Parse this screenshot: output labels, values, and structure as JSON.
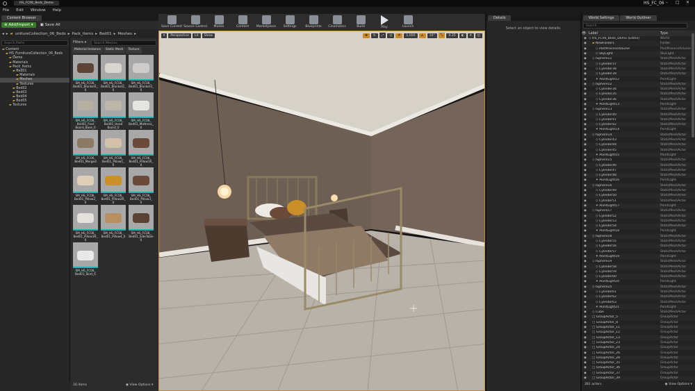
{
  "window": {
    "title": "HS_FC06_Beds_Demo",
    "project": "HS_FC_06"
  },
  "menu": [
    "File",
    "Edit",
    "Window",
    "Help"
  ],
  "content_browser": {
    "tab": "Content Browser",
    "add_import": "Add/Import",
    "save_all": "Save All",
    "breadcrumb": [
      "unitureCollection_06_Beds",
      "Pack_Items",
      "Bed01",
      "Meshes"
    ],
    "search_paths_placeholder": "Search Paths",
    "filters_label": "Filters",
    "search_assets_placeholder": "Search Meshes",
    "filter_tabs": [
      "Material Instance",
      "Static Mesh",
      "Texture"
    ],
    "tree": [
      {
        "label": "Content",
        "depth": 0
      },
      {
        "label": "HS_FurnitureCollection_06_Beds",
        "depth": 1
      },
      {
        "label": "Demo",
        "depth": 2
      },
      {
        "label": "Materials",
        "depth": 2
      },
      {
        "label": "Pack_Items",
        "depth": 2
      },
      {
        "label": "Bed01",
        "depth": 3
      },
      {
        "label": "Materials",
        "depth": 4
      },
      {
        "label": "Meshes",
        "depth": 4
      },
      {
        "label": "Textures",
        "depth": 4
      },
      {
        "label": "Bed02",
        "depth": 3
      },
      {
        "label": "Bed03",
        "depth": 3
      },
      {
        "label": "Bed04",
        "depth": 3
      },
      {
        "label": "Bed05",
        "depth": 3
      },
      {
        "label": "Textures",
        "depth": 2
      }
    ],
    "assets": [
      {
        "name": "SM_HS_FC06_ Bed01_Blanket1_ 0"
      },
      {
        "name": "SM_HS_FC06_ Bed01_Blanket2_ 0"
      },
      {
        "name": "SM_HS_FC06_ Bed01_Blanket3_ 0"
      },
      {
        "name": "SM_HS_FC06_ Bed01_Foot Board_Base_0"
      },
      {
        "name": "SM_HS_FC06_ Bed01_Head Board_0"
      },
      {
        "name": "SM_HS_FC06_ Bed01_Mattress_ 0"
      },
      {
        "name": "SM_HS_FC06_ Bed01_Merged"
      },
      {
        "name": "SM_HS_FC06_ Bed01_Pillow1_ 0"
      },
      {
        "name": "SM_HS_FC06_ Bed01_Pillow1R_ 0"
      },
      {
        "name": "SM_HS_FC06_ Bed01_Pillow2_ 0"
      },
      {
        "name": "SM_HS_FC06_ Bed01_Pillow2R_ 0"
      },
      {
        "name": "SM_HS_FC06_ Bed01_Pillow3_ 0"
      },
      {
        "name": "SM_HS_FC06_ Bed01_Pillow3R_ 0"
      },
      {
        "name": "SM_HS_FC06_ Bed01_Pillow4_0"
      },
      {
        "name": "SM_HS_FC06_ Bed01_SideTable 0"
      },
      {
        "name": "SM_HS_FC06_ Bed01_Skirt_0"
      }
    ],
    "item_count": "16 items",
    "view_options": "View Options"
  },
  "toolbar": [
    "Save Current",
    "Source Control",
    "Modes",
    "Content",
    "Marketplace",
    "Settings",
    "Blueprints",
    "Cinematics",
    "Build",
    "Play",
    "Launch"
  ],
  "viewport": {
    "perspective": "Perspective",
    "lit": "Lit",
    "show": "Show",
    "grid_snap": "1,000",
    "rot_snap": "10°",
    "scale_snap": "0.25",
    "cam_speed": "4"
  },
  "details": {
    "tab": "Details",
    "empty_message": "Select an object to view details."
  },
  "outliner": {
    "tabs": [
      "World Settings",
      "World Outliner"
    ],
    "search_placeholder": "Search...",
    "col_label": "Label",
    "col_type": "Type",
    "rows": [
      {
        "label": "HS_FC06_Beds_Demo (Editor)",
        "type": "World",
        "d": 0
      },
      {
        "label": "NewFolder1",
        "type": "Folder",
        "d": 1
      },
      {
        "label": "PostProcessVolume",
        "type": "PostProcessVolume",
        "d": 2
      },
      {
        "label": "SkyLight",
        "type": "SkyLight",
        "d": 2
      },
      {
        "label": "ISphere11",
        "type": "StaticMeshActor",
        "d": 1
      },
      {
        "label": "Cylinder37",
        "type": "StaticMeshActor",
        "d": 2
      },
      {
        "label": "Cylinder38",
        "type": "StaticMeshActor",
        "d": 2
      },
      {
        "label": "Cylinder39",
        "type": "StaticMeshActor",
        "d": 2
      },
      {
        "label": "PointLight12",
        "type": "PointLight",
        "d": 2
      },
      {
        "label": "ISphere12",
        "type": "StaticMeshActor",
        "d": 1
      },
      {
        "label": "Cylinder34",
        "type": "StaticMeshActor",
        "d": 2
      },
      {
        "label": "Cylinder35",
        "type": "StaticMeshActor",
        "d": 2
      },
      {
        "label": "Cylinder36",
        "type": "StaticMeshActor",
        "d": 2
      },
      {
        "label": "PointLight13",
        "type": "PointLight",
        "d": 2
      },
      {
        "label": "ISphere13",
        "type": "StaticMeshActor",
        "d": 1
      },
      {
        "label": "Cylinder40",
        "type": "StaticMeshActor",
        "d": 2
      },
      {
        "label": "Cylinder41",
        "type": "StaticMeshActor",
        "d": 2
      },
      {
        "label": "Cylinder42",
        "type": "StaticMeshActor",
        "d": 2
      },
      {
        "label": "PointLight14",
        "type": "PointLight",
        "d": 2
      },
      {
        "label": "ISphere14",
        "type": "StaticMeshActor",
        "d": 1
      },
      {
        "label": "Cylinder43",
        "type": "StaticMeshActor",
        "d": 2
      },
      {
        "label": "Cylinder44",
        "type": "StaticMeshActor",
        "d": 2
      },
      {
        "label": "Cylinder45",
        "type": "StaticMeshActor",
        "d": 2
      },
      {
        "label": "PointLight15",
        "type": "PointLight",
        "d": 2
      },
      {
        "label": "ISphere15",
        "type": "StaticMeshActor",
        "d": 1
      },
      {
        "label": "Cylinder46",
        "type": "StaticMeshActor",
        "d": 2
      },
      {
        "label": "Cylinder47",
        "type": "StaticMeshActor",
        "d": 2
      },
      {
        "label": "Cylinder48",
        "type": "StaticMeshActor",
        "d": 2
      },
      {
        "label": "PointLight16",
        "type": "PointLight",
        "d": 2
      },
      {
        "label": "ISphere16",
        "type": "StaticMeshActor",
        "d": 1
      },
      {
        "label": "Cylinder49",
        "type": "StaticMeshActor",
        "d": 2
      },
      {
        "label": "Cylinder50",
        "type": "StaticMeshActor",
        "d": 2
      },
      {
        "label": "Cylinder51",
        "type": "StaticMeshActor",
        "d": 2
      },
      {
        "label": "PointLight17",
        "type": "PointLight",
        "d": 2
      },
      {
        "label": "ISphere17",
        "type": "StaticMeshActor",
        "d": 1
      },
      {
        "label": "Cylinder52",
        "type": "StaticMeshActor",
        "d": 2
      },
      {
        "label": "Cylinder53",
        "type": "StaticMeshActor",
        "d": 2
      },
      {
        "label": "Cylinder54",
        "type": "StaticMeshActor",
        "d": 2
      },
      {
        "label": "PointLight18",
        "type": "PointLight",
        "d": 2
      },
      {
        "label": "ISphere18",
        "type": "StaticMeshActor",
        "d": 1
      },
      {
        "label": "Cylinder55",
        "type": "StaticMeshActor",
        "d": 2
      },
      {
        "label": "Cylinder56",
        "type": "StaticMeshActor",
        "d": 2
      },
      {
        "label": "Cylinder57",
        "type": "StaticMeshActor",
        "d": 2
      },
      {
        "label": "PointLight19",
        "type": "PointLight",
        "d": 2
      },
      {
        "label": "ISphere19",
        "type": "StaticMeshActor",
        "d": 1
      },
      {
        "label": "Cylinder58",
        "type": "StaticMeshActor",
        "d": 2
      },
      {
        "label": "Cylinder59",
        "type": "StaticMeshActor",
        "d": 2
      },
      {
        "label": "Cylinder60",
        "type": "StaticMeshActor",
        "d": 2
      },
      {
        "label": "PointLight20",
        "type": "PointLight",
        "d": 2
      },
      {
        "label": "ISphere20",
        "type": "StaticMeshActor",
        "d": 1
      },
      {
        "label": "Cylinder61",
        "type": "StaticMeshActor",
        "d": 2
      },
      {
        "label": "Cylinder62",
        "type": "StaticMeshActor",
        "d": 2
      },
      {
        "label": "Cylinder63",
        "type": "StaticMeshActor",
        "d": 2
      },
      {
        "label": "PointLight21",
        "type": "PointLight",
        "d": 2
      },
      {
        "label": "Cube",
        "type": "StaticMeshActor",
        "d": 1
      },
      {
        "label": "GroupActor_5",
        "type": "GroupActor",
        "d": 1
      },
      {
        "label": "GroupActor_8",
        "type": "GroupActor",
        "d": 1
      },
      {
        "label": "GroupActor_11",
        "type": "GroupActor",
        "d": 1
      },
      {
        "label": "GroupActor_12",
        "type": "GroupActor",
        "d": 1
      },
      {
        "label": "GroupActor_13",
        "type": "GroupActor",
        "d": 1
      },
      {
        "label": "GroupActor_23",
        "type": "GroupActor",
        "d": 1
      },
      {
        "label": "GroupActor_24",
        "type": "GroupActor",
        "d": 1
      },
      {
        "label": "GroupActor_26",
        "type": "GroupActor",
        "d": 1
      },
      {
        "label": "GroupActor_28",
        "type": "GroupActor",
        "d": 1
      },
      {
        "label": "GroupActor_35",
        "type": "GroupActor",
        "d": 1
      },
      {
        "label": "GroupActor_36",
        "type": "GroupActor",
        "d": 1
      },
      {
        "label": "GroupActor_37",
        "type": "GroupActor",
        "d": 1
      },
      {
        "label": "GroupActor_39",
        "type": "GroupActor",
        "d": 1
      },
      {
        "label": "GroupActor_41",
        "type": "GroupActor",
        "d": 1
      }
    ],
    "actor_count": "281 actors",
    "view_options": "View Options"
  },
  "colors": {
    "accent": "#c78a2c",
    "asset_underline": "#1fb3b3",
    "add_button": "#3a7d2a"
  }
}
